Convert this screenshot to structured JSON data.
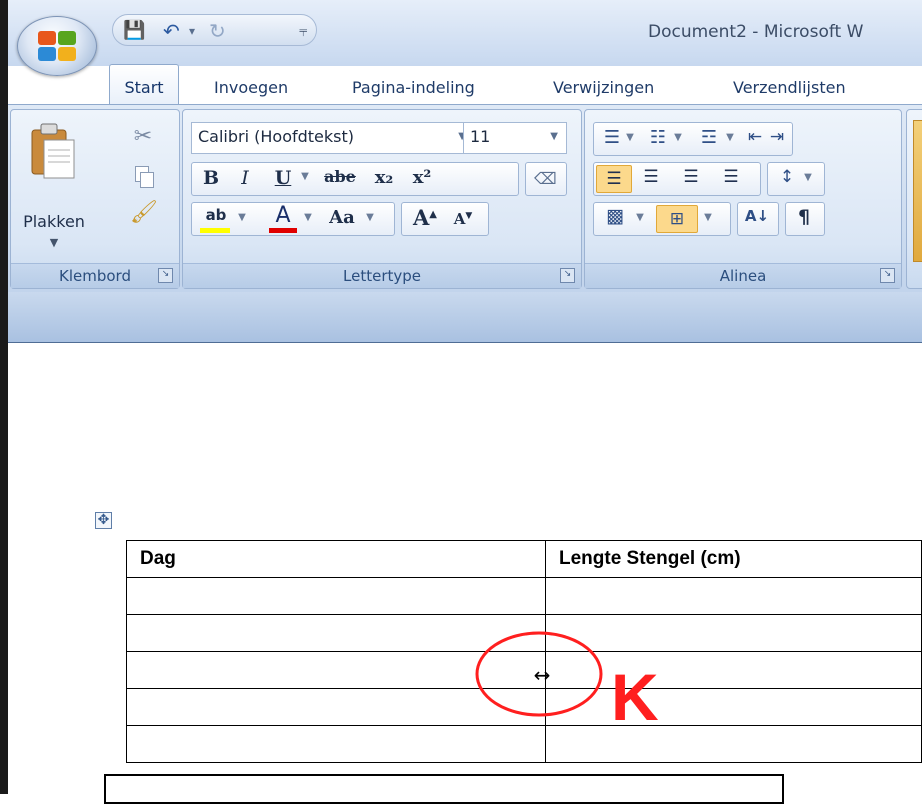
{
  "window": {
    "title": "Document2 - Microsoft W"
  },
  "quick_access": {
    "items": [
      {
        "icon": "save-icon",
        "glyph": "💾"
      },
      {
        "icon": "undo-icon",
        "glyph": "↶"
      },
      {
        "icon": "dropdown-icon",
        "glyph": "▾"
      },
      {
        "icon": "redo-icon",
        "glyph": "↻"
      },
      {
        "icon": "customize-icon",
        "glyph": "⫧"
      }
    ]
  },
  "tabs": [
    "Start",
    "Invoegen",
    "Pagina-indeling",
    "Verwijzingen",
    "Verzendlijsten"
  ],
  "ribbon": {
    "klembord": {
      "label": "Klembord",
      "paste_label": "Plakken"
    },
    "lettertype": {
      "label": "Lettertype",
      "font_name": "Calibri (Hoofdtekst)",
      "font_size": "11",
      "bold": "B",
      "italic": "I",
      "underline": "U",
      "strike": "abe",
      "subscript": "x₂",
      "superscript": "x²",
      "highlight": "ab",
      "font_color": "A",
      "case": "Aa",
      "grow": "A",
      "shrink": "A"
    },
    "alinea": {
      "label": "Alinea",
      "pilcrow": "¶",
      "sort": "A↓"
    }
  },
  "colors": {
    "highlight": "#ffff00",
    "font_color": "#e00000",
    "annotation": "#ff1f1f"
  },
  "document": {
    "table": {
      "headers": [
        "Dag",
        "Lengte Stengel (cm)"
      ],
      "empty_rows": 5
    }
  },
  "annotation": {
    "letter": "K",
    "cursor": "↔"
  }
}
